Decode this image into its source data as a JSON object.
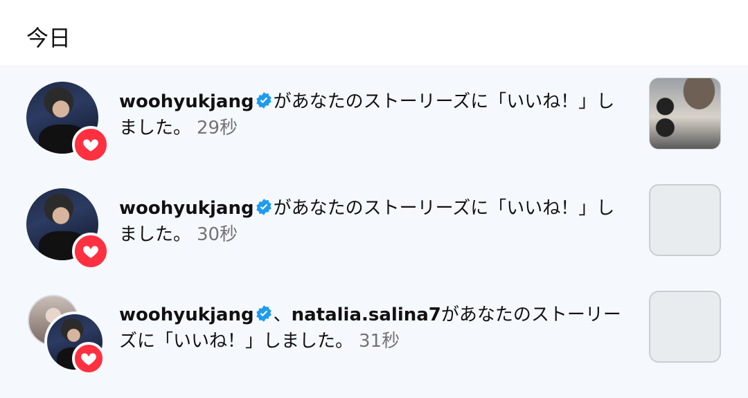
{
  "section": {
    "title": "今日"
  },
  "notifications": [
    {
      "username": "woohyukjang",
      "verified": true,
      "message": "があなたのストーリーズに「いいね！」しました。",
      "time": "29秒",
      "thumbnail": "story-photo"
    },
    {
      "username": "woohyukjang",
      "verified": true,
      "message": "があなたのストーリーズに「いいね！」しました。",
      "time": "30秒",
      "thumbnail": "empty"
    },
    {
      "username": "woohyukjang",
      "verified": true,
      "separator": "、",
      "username2": "natalia.salina7",
      "message": "があなたのストーリーズに「いいね！」しました。",
      "time": "31秒",
      "thumbnail": "empty"
    }
  ],
  "icons": {
    "badge": "heart-icon",
    "verified": "verified-badge-icon"
  },
  "colors": {
    "heart": "#ff3040",
    "verified": "#1d9bf0",
    "background": "#f5f9fd",
    "time": "#737373"
  }
}
